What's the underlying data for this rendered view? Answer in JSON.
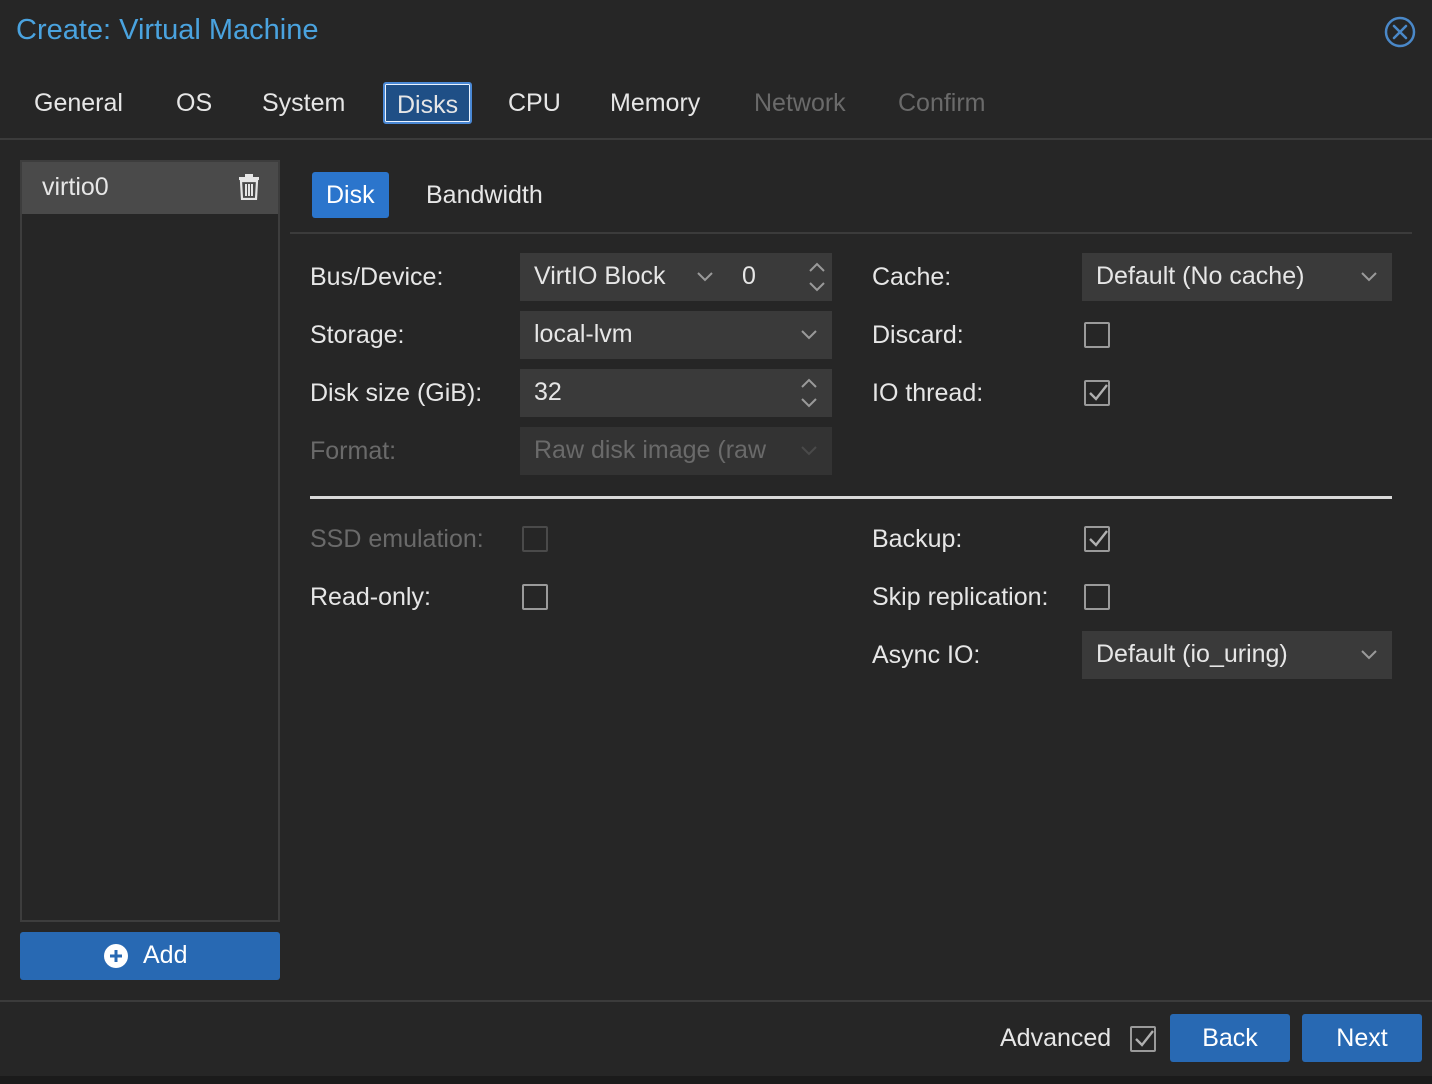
{
  "dialog": {
    "title": "Create: Virtual Machine"
  },
  "tabs": [
    {
      "label": "General",
      "state": "enabled"
    },
    {
      "label": "OS",
      "state": "enabled"
    },
    {
      "label": "System",
      "state": "enabled"
    },
    {
      "label": "Disks",
      "state": "active"
    },
    {
      "label": "CPU",
      "state": "enabled"
    },
    {
      "label": "Memory",
      "state": "enabled"
    },
    {
      "label": "Network",
      "state": "disabled"
    },
    {
      "label": "Confirm",
      "state": "disabled"
    }
  ],
  "disk_list": {
    "items": [
      {
        "label": "virtio0"
      }
    ],
    "add_label": "Add"
  },
  "subtabs": [
    {
      "label": "Disk",
      "active": true
    },
    {
      "label": "Bandwidth",
      "active": false
    }
  ],
  "form": {
    "bus_device": {
      "label": "Bus/Device:",
      "bus": "VirtIO Block",
      "device": "0"
    },
    "storage": {
      "label": "Storage:",
      "value": "local-lvm"
    },
    "disk_size": {
      "label": "Disk size (GiB):",
      "value": "32"
    },
    "format": {
      "label": "Format:",
      "value": "Raw disk image (raw",
      "disabled": true
    },
    "cache": {
      "label": "Cache:",
      "value": "Default (No cache)"
    },
    "discard": {
      "label": "Discard:",
      "checked": false
    },
    "io_thread": {
      "label": "IO thread:",
      "checked": true
    },
    "ssd_emulation": {
      "label": "SSD emulation:",
      "checked": false,
      "disabled": true
    },
    "read_only": {
      "label": "Read-only:",
      "checked": false
    },
    "backup": {
      "label": "Backup:",
      "checked": true
    },
    "skip_replication": {
      "label": "Skip replication:",
      "checked": false
    },
    "async_io": {
      "label": "Async IO:",
      "value": "Default (io_uring)"
    }
  },
  "footer": {
    "advanced_label": "Advanced",
    "advanced_checked": true,
    "back_label": "Back",
    "next_label": "Next"
  },
  "colors": {
    "background": "#262626",
    "accent": "#2869b3",
    "title": "#4aa3df",
    "text": "#e6e6e6",
    "disabled_text": "#6a6a6a"
  }
}
